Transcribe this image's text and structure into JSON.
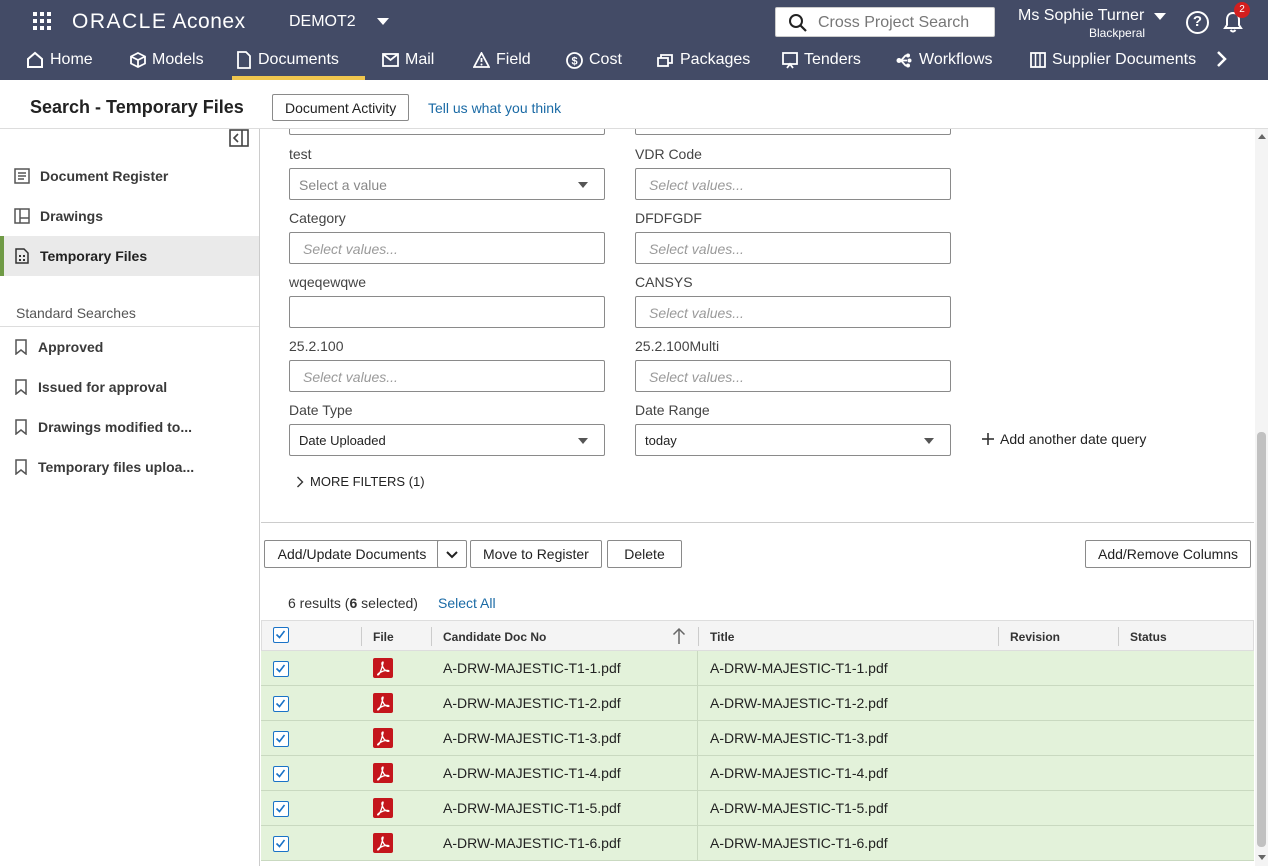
{
  "app": {
    "logo_oracle": "ORACLE",
    "logo_product": "Aconex",
    "project": "DEMOT2",
    "search_placeholder": "Cross Project Search",
    "user_name": "Ms Sophie Turner",
    "user_org": "Blackperal",
    "notification_count": "2"
  },
  "nav": {
    "items": [
      {
        "label": "Home",
        "icon": "home-icon"
      },
      {
        "label": "Models",
        "icon": "cube-icon"
      },
      {
        "label": "Documents",
        "icon": "document-icon",
        "active": true
      },
      {
        "label": "Mail",
        "icon": "mail-icon"
      },
      {
        "label": "Field",
        "icon": "warning-icon"
      },
      {
        "label": "Cost",
        "icon": "dollar-icon"
      },
      {
        "label": "Packages",
        "icon": "packages-icon"
      },
      {
        "label": "Tenders",
        "icon": "tenders-icon"
      },
      {
        "label": "Workflows",
        "icon": "workflow-icon"
      },
      {
        "label": "Supplier Documents",
        "icon": "supplier-documents-icon"
      }
    ]
  },
  "header": {
    "title": "Search - Temporary Files",
    "document_activity": "Document Activity",
    "feedback": "Tell us what you think"
  },
  "sidebar": {
    "items": [
      {
        "label": "Document Register"
      },
      {
        "label": "Drawings"
      },
      {
        "label": "Temporary Files",
        "active": true
      }
    ],
    "standard_searches_title": "Standard Searches",
    "searches": [
      {
        "label": "Approved"
      },
      {
        "label": "Issued for approval"
      },
      {
        "label": "Drawings modified to..."
      },
      {
        "label": "Temporary files uploa..."
      }
    ]
  },
  "filters": {
    "test_label": "test",
    "test_placeholder": "Select a value",
    "vdr_label": "VDR Code",
    "vdr_placeholder": "Select values...",
    "category_label": "Category",
    "category_placeholder": "Select values...",
    "dfdf_label": "DFDFGDF",
    "dfdf_placeholder": "Select values...",
    "wqe_label": "wqeqewqwe",
    "wqe_value": "",
    "cansys_label": "CANSYS",
    "cansys_placeholder": "Select values...",
    "v25_label": "25.2.100",
    "v25_placeholder": "Select values...",
    "v25m_label": "25.2.100Multi",
    "v25m_placeholder": "Select values...",
    "date_type_label": "Date Type",
    "date_type_value": "Date Uploaded",
    "date_range_label": "Date Range",
    "date_range_value": "today",
    "add_date_query": "Add another date query",
    "more_filters": "MORE FILTERS (1)"
  },
  "toolbar": {
    "add_update": "Add/Update Documents",
    "move_to_register": "Move to Register",
    "delete": "Delete",
    "add_remove_columns": "Add/Remove Columns"
  },
  "results": {
    "count_prefix": "6 results (",
    "selected_count": "6",
    "count_suffix": " selected)",
    "select_all": "Select All"
  },
  "table": {
    "columns": {
      "file": "File",
      "candidate_doc_no": "Candidate Doc No",
      "title": "Title",
      "revision": "Revision",
      "status": "Status"
    },
    "rows": [
      {
        "doc_no": "A-DRW-MAJESTIC-T1-1.pdf",
        "title": "A-DRW-MAJESTIC-T1-1.pdf",
        "revision": "",
        "status": ""
      },
      {
        "doc_no": "A-DRW-MAJESTIC-T1-2.pdf",
        "title": "A-DRW-MAJESTIC-T1-2.pdf",
        "revision": "",
        "status": ""
      },
      {
        "doc_no": "A-DRW-MAJESTIC-T1-3.pdf",
        "title": "A-DRW-MAJESTIC-T1-3.pdf",
        "revision": "",
        "status": ""
      },
      {
        "doc_no": "A-DRW-MAJESTIC-T1-4.pdf",
        "title": "A-DRW-MAJESTIC-T1-4.pdf",
        "revision": "",
        "status": ""
      },
      {
        "doc_no": "A-DRW-MAJESTIC-T1-5.pdf",
        "title": "A-DRW-MAJESTIC-T1-5.pdf",
        "revision": "",
        "status": ""
      },
      {
        "doc_no": "A-DRW-MAJESTIC-T1-6.pdf",
        "title": "A-DRW-MAJESTIC-T1-6.pdf",
        "revision": "",
        "status": ""
      }
    ]
  },
  "colors": {
    "topbar": "#434b66",
    "active_tab_underline": "#f0c64e",
    "selected_row": "#e3f2da",
    "link": "#1a6aa5",
    "sidebar_active_bar": "#6f9a45"
  }
}
